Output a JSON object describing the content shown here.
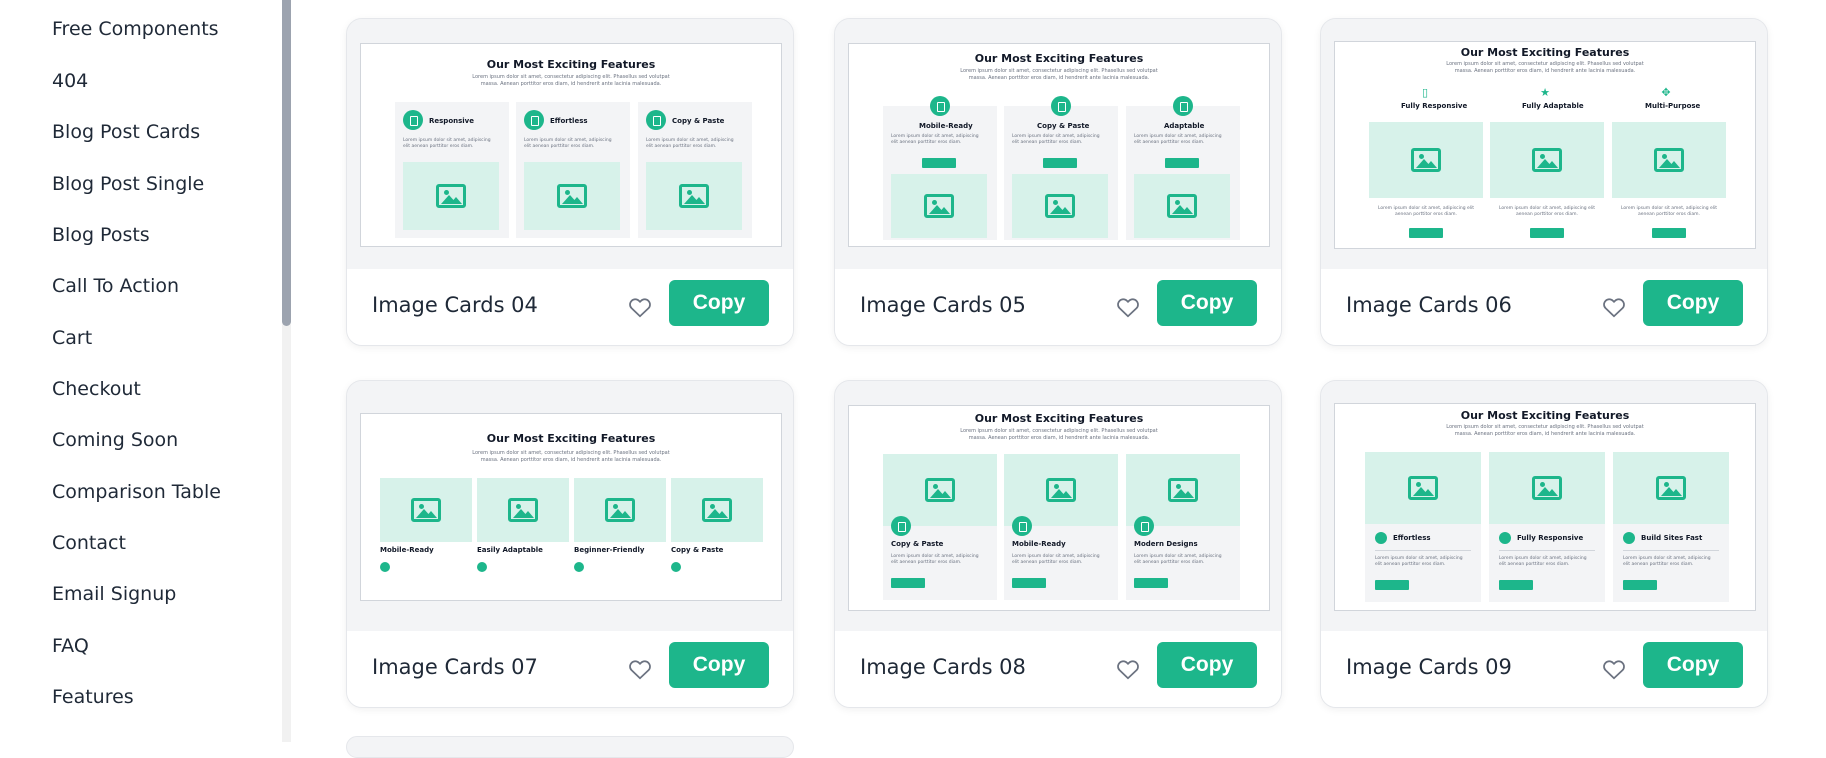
{
  "sidebar": {
    "items": [
      {
        "label": "Free Components"
      },
      {
        "label": "404"
      },
      {
        "label": "Blog Post Cards"
      },
      {
        "label": "Blog Post Single"
      },
      {
        "label": "Blog Posts"
      },
      {
        "label": "Call To Action"
      },
      {
        "label": "Cart"
      },
      {
        "label": "Checkout"
      },
      {
        "label": "Coming Soon"
      },
      {
        "label": "Comparison Table"
      },
      {
        "label": "Contact"
      },
      {
        "label": "Email Signup"
      },
      {
        "label": "FAQ"
      },
      {
        "label": "Features"
      }
    ]
  },
  "cards": [
    {
      "title": "Image Cards 04",
      "copy_label": "Copy"
    },
    {
      "title": "Image Cards 05",
      "copy_label": "Copy"
    },
    {
      "title": "Image Cards 06",
      "copy_label": "Copy"
    },
    {
      "title": "Image Cards 07",
      "copy_label": "Copy"
    },
    {
      "title": "Image Cards 08",
      "copy_label": "Copy"
    },
    {
      "title": "Image Cards 09",
      "copy_label": "Copy"
    }
  ],
  "previews": {
    "heading": "Our Most Exciting Features",
    "subtext": "Lorem ipsum dolor sit amet, consectetur adipiscing elit. Phasellus sed volutpat massa. Aenean porttitor eros diam, id hendrerit ante lacinia malesuada.",
    "desc": "Lorem ipsum dolor sit amet, adipiscing elit aenean porttitor eros diam.",
    "p04": [
      "Responsive",
      "Effortless",
      "Copy & Paste"
    ],
    "p05": [
      "Mobile-Ready",
      "Copy & Paste",
      "Adaptable"
    ],
    "p06": [
      "Fully Responsive",
      "Fully Adaptable",
      "Multi-Purpose"
    ],
    "p07": [
      "Mobile-Ready",
      "Easily Adaptable",
      "Beginner-Friendly",
      "Copy & Paste"
    ],
    "p08": [
      "Copy & Paste",
      "Mobile-Ready",
      "Modern Designs"
    ],
    "p09": [
      "Effortless",
      "Fully Responsive",
      "Build Sites Fast"
    ]
  },
  "colors": {
    "accent": "#1db68b",
    "image_bg": "#d7f2ea",
    "heart": "#6b7280"
  },
  "icons": {
    "heart": "heart-icon",
    "image": "image-icon"
  }
}
